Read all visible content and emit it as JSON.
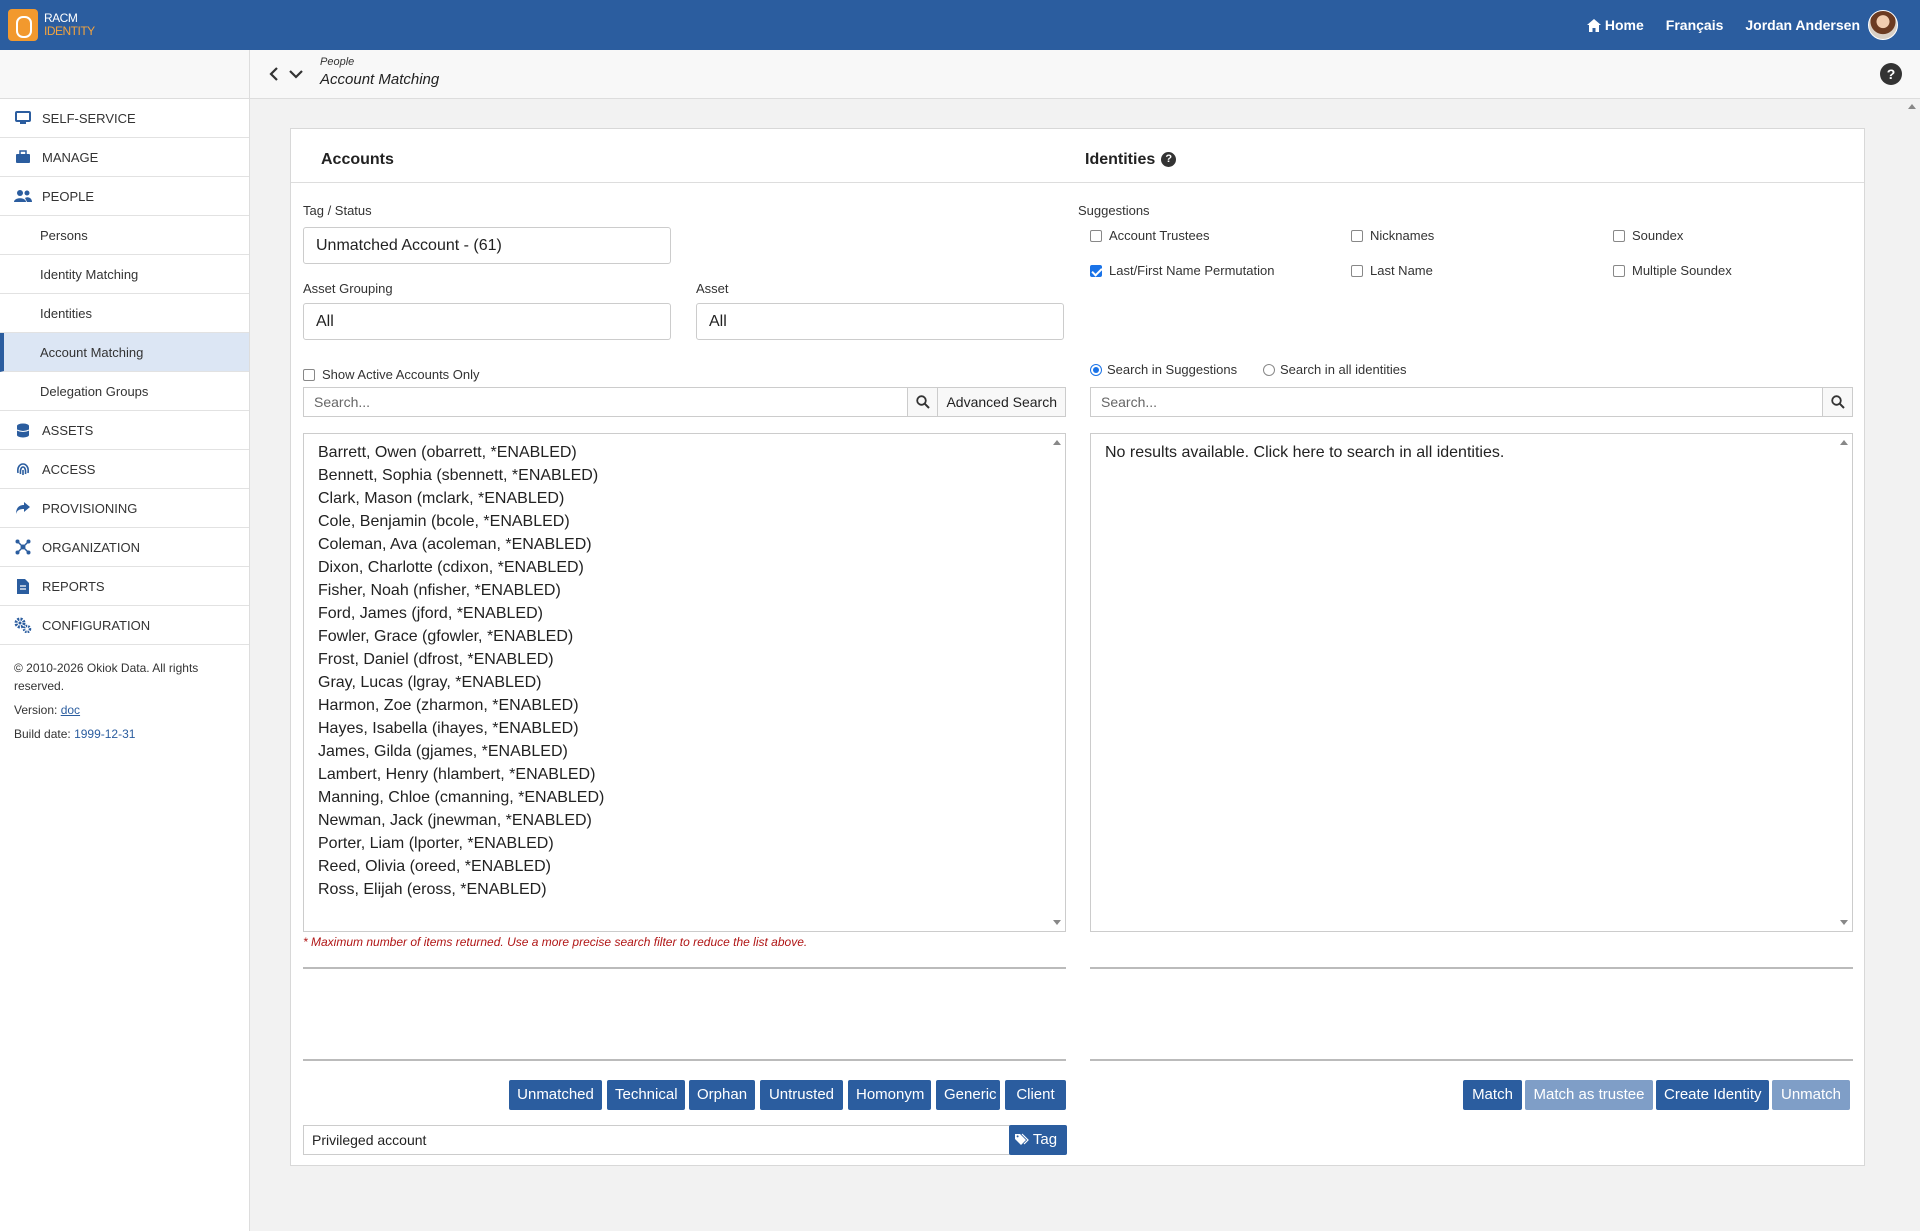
{
  "header": {
    "logo_line1": "RACM",
    "logo_line2": "IDENTITY",
    "home": "Home",
    "language": "Français",
    "user": "Jordan Andersen"
  },
  "breadcrumb": {
    "section": "People",
    "page": "Account Matching"
  },
  "sidebar": {
    "items": [
      {
        "label": "SELF-SERVICE",
        "icon": "monitor-icon"
      },
      {
        "label": "MANAGE",
        "icon": "briefcase-icon"
      },
      {
        "label": "PEOPLE",
        "icon": "users-icon"
      }
    ],
    "people_sub": [
      "Persons",
      "Identity Matching",
      "Identities",
      "Account Matching",
      "Delegation Groups"
    ],
    "items2": [
      {
        "label": "ASSETS",
        "icon": "database-icon"
      },
      {
        "label": "ACCESS",
        "icon": "fingerprint-icon"
      },
      {
        "label": "PROVISIONING",
        "icon": "share-icon"
      },
      {
        "label": "ORGANIZATION",
        "icon": "network-icon"
      },
      {
        "label": "REPORTS",
        "icon": "file-icon"
      },
      {
        "label": "CONFIGURATION",
        "icon": "gears-icon"
      }
    ],
    "footer": {
      "copyright": "© 2010-2026 Okiok Data. All rights reserved.",
      "version_label": "Version:",
      "version_link": "doc",
      "build_label": "Build date:",
      "build_date": "1999-12-31"
    }
  },
  "accounts": {
    "title": "Accounts",
    "tag_status_label": "Tag / Status",
    "tag_status_value": "Unmatched Account - (61)",
    "asset_grouping_label": "Asset Grouping",
    "asset_grouping_value": "All",
    "asset_label": "Asset",
    "asset_value": "All",
    "active_only_label": "Show Active Accounts Only",
    "search_placeholder": "Search...",
    "advanced_search": "Advanced Search",
    "list": [
      "Barrett, Owen (obarrett, *ENABLED)",
      "Bennett, Sophia (sbennett, *ENABLED)",
      "Clark, Mason (mclark, *ENABLED)",
      "Cole, Benjamin (bcole, *ENABLED)",
      "Coleman, Ava (acoleman, *ENABLED)",
      "Dixon, Charlotte (cdixon, *ENABLED)",
      "Fisher, Noah (nfisher, *ENABLED)",
      "Ford, James (jford, *ENABLED)",
      "Fowler, Grace (gfowler, *ENABLED)",
      "Frost, Daniel (dfrost, *ENABLED)",
      "Gray, Lucas (lgray, *ENABLED)",
      "Harmon, Zoe (zharmon, *ENABLED)",
      "Hayes, Isabella (ihayes, *ENABLED)",
      "James, Gilda (gjames, *ENABLED)",
      "Lambert, Henry (hlambert, *ENABLED)",
      "Manning, Chloe (cmanning, *ENABLED)",
      "Newman, Jack (jnewman, *ENABLED)",
      "Porter, Liam (lporter, *ENABLED)",
      "Reed, Olivia (oreed, *ENABLED)",
      "Ross, Elijah (eross, *ENABLED)"
    ],
    "max_warning": "* Maximum number of items returned. Use a more precise search filter to reduce the list above.",
    "tag_buttons": [
      "Unmatched",
      "Technical",
      "Orphan",
      "Untrusted",
      "Homonym",
      "Generic",
      "Client"
    ],
    "tag_input_value": "Privileged account",
    "tag_button": "Tag"
  },
  "identities": {
    "title": "Identities",
    "suggestions_label": "Suggestions",
    "suggestions": [
      {
        "label": "Account Trustees",
        "checked": false
      },
      {
        "label": "Nicknames",
        "checked": false
      },
      {
        "label": "Soundex",
        "checked": false
      },
      {
        "label": "Last/First Name Permutation",
        "checked": true
      },
      {
        "label": "Last Name",
        "checked": false
      },
      {
        "label": "Multiple Soundex",
        "checked": false
      }
    ],
    "radio_suggestions": "Search in Suggestions",
    "radio_all": "Search in all identities",
    "search_placeholder": "Search...",
    "no_results": "No results available. Click here to search in all identities.",
    "buttons": [
      "Match",
      "Match as trustee",
      "Create Identity",
      "Unmatch"
    ]
  },
  "colors": {
    "primary": "#2b5d9f",
    "accent": "#f2992e",
    "warning": "#b01515"
  }
}
